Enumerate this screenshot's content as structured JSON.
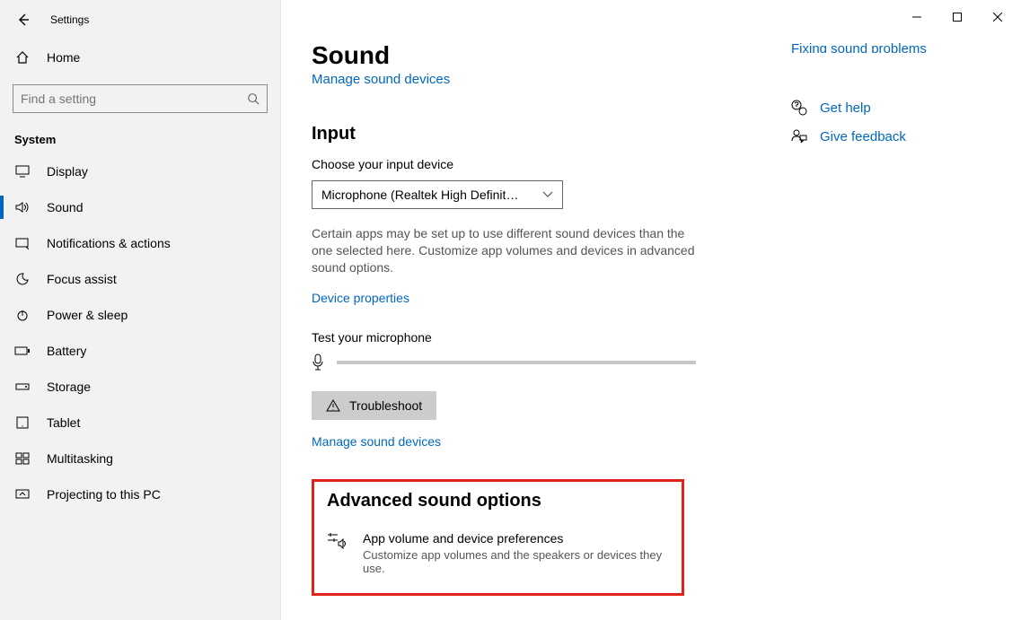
{
  "window": {
    "title": "Settings"
  },
  "sidebar": {
    "home": "Home",
    "search_placeholder": "Find a setting",
    "section": "System",
    "items": [
      {
        "label": "Display"
      },
      {
        "label": "Sound"
      },
      {
        "label": "Notifications & actions"
      },
      {
        "label": "Focus assist"
      },
      {
        "label": "Power & sleep"
      },
      {
        "label": "Battery"
      },
      {
        "label": "Storage"
      },
      {
        "label": "Tablet"
      },
      {
        "label": "Multitasking"
      },
      {
        "label": "Projecting to this PC"
      }
    ]
  },
  "main": {
    "heading": "Sound",
    "clipped_link": "Manage sound devices",
    "input_section": {
      "title": "Input",
      "choose_label": "Choose your input device",
      "selected_device": "Microphone (Realtek High Definitio…",
      "desc": "Certain apps may be set up to use different sound devices than the one selected here. Customize app volumes and devices in advanced sound options.",
      "device_props": "Device properties",
      "test_label": "Test your microphone",
      "troubleshoot": "Troubleshoot",
      "manage_devices": "Manage sound devices"
    },
    "advanced": {
      "title": "Advanced sound options",
      "row_title": "App volume and device preferences",
      "row_desc": "Customize app volumes and the speakers or devices they use."
    }
  },
  "side": {
    "clipped_link": "Fixing sound problems",
    "help": "Get help",
    "feedback": "Give feedback"
  }
}
